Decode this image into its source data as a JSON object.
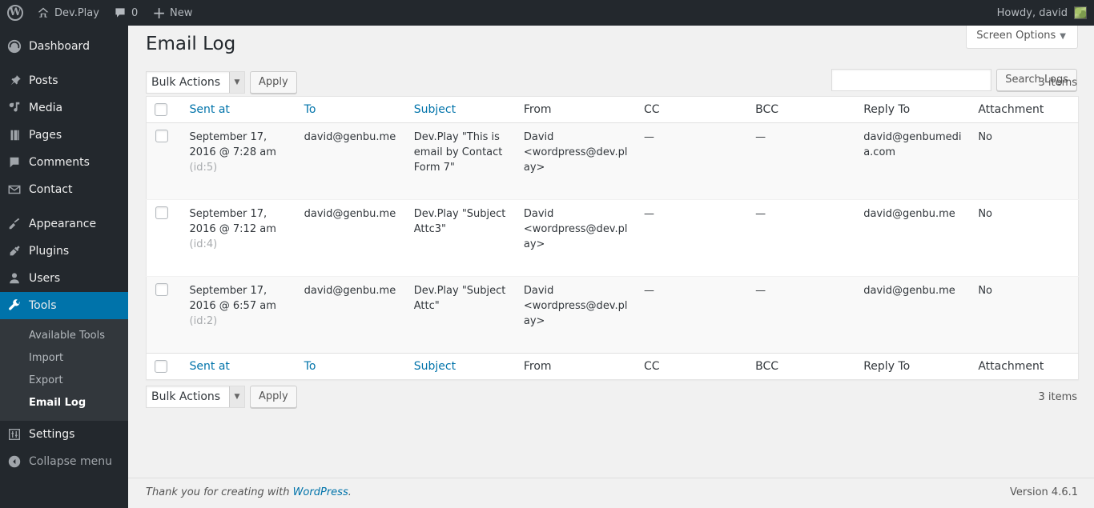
{
  "adminbar": {
    "wp_logo": "wordpress-logo",
    "site_name": "Dev.Play",
    "comment_count": "0",
    "new_label": "New",
    "howdy": "Howdy, david"
  },
  "sidebar": {
    "items": [
      {
        "label": "Dashboard",
        "icon": "dashboard-icon",
        "name": "dashboard"
      },
      {
        "label": "Posts",
        "icon": "pin-icon",
        "name": "posts"
      },
      {
        "label": "Media",
        "icon": "media-icon",
        "name": "media"
      },
      {
        "label": "Pages",
        "icon": "pages-icon",
        "name": "pages"
      },
      {
        "label": "Comments",
        "icon": "comments-icon",
        "name": "comments"
      },
      {
        "label": "Contact",
        "icon": "mail-icon",
        "name": "contact"
      },
      {
        "label": "Appearance",
        "icon": "brush-icon",
        "name": "appearance"
      },
      {
        "label": "Plugins",
        "icon": "plugin-icon",
        "name": "plugins"
      },
      {
        "label": "Users",
        "icon": "user-icon",
        "name": "users"
      },
      {
        "label": "Tools",
        "icon": "wrench-icon",
        "name": "tools"
      },
      {
        "label": "Settings",
        "icon": "settings-icon",
        "name": "settings"
      }
    ],
    "submenu": [
      {
        "label": "Available Tools",
        "current": false
      },
      {
        "label": "Import",
        "current": false
      },
      {
        "label": "Export",
        "current": false
      },
      {
        "label": "Email Log",
        "current": true
      }
    ],
    "collapse_label": "Collapse menu",
    "current_item": "Tools",
    "accent_color": "#0073aa",
    "background_color": "#23282d",
    "submenu_background": "#32373c"
  },
  "screen_options": {
    "label": "Screen Options",
    "caret": "▼"
  },
  "page": {
    "title": "Email Log"
  },
  "search": {
    "value": "",
    "placeholder": "",
    "button_label": "Search Logs"
  },
  "tablenav_top": {
    "bulk_label": "Bulk Actions",
    "apply_label": "Apply",
    "items_count": "3 items"
  },
  "tablenav_bottom": {
    "bulk_label": "Bulk Actions",
    "apply_label": "Apply",
    "items_count": "3 items"
  },
  "table": {
    "columns": [
      {
        "label": "Sent at",
        "link": true
      },
      {
        "label": "To",
        "link": true
      },
      {
        "label": "Subject",
        "link": true
      },
      {
        "label": "From",
        "link": false
      },
      {
        "label": "CC",
        "link": false
      },
      {
        "label": "BCC",
        "link": false
      },
      {
        "label": "Reply To",
        "link": false
      },
      {
        "label": "Attachment",
        "link": false
      }
    ],
    "rows": [
      {
        "date": "September 17, 2016",
        "time": "@ 7:28 am",
        "id": "(id:5)",
        "to": "david@genbu.me",
        "subject": "Dev.Play \"This is email by Contact Form 7\"",
        "from": "David <wordpress@dev.play>",
        "cc": "—",
        "bcc": "—",
        "reply_to": "david@genbumedia.com",
        "attachment": "No"
      },
      {
        "date": "September 17, 2016",
        "time": "@ 7:12 am",
        "id": "(id:4)",
        "to": "david@genbu.me",
        "subject": "Dev.Play \"Subject Attc3\"",
        "from": "David <wordpress@dev.play>",
        "cc": "—",
        "bcc": "—",
        "reply_to": "david@genbu.me",
        "attachment": "No"
      },
      {
        "date": "September 17, 2016",
        "time": "@ 6:57 am",
        "id": "(id:2)",
        "to": "david@genbu.me",
        "subject": "Dev.Play \"Subject Attc\"",
        "from": "David <wordpress@dev.play>",
        "cc": "—",
        "bcc": "—",
        "reply_to": "david@genbu.me",
        "attachment": "No"
      }
    ]
  },
  "footer": {
    "thankyou_prefix": "Thank you for creating with ",
    "wordpress_link": "WordPress",
    "thankyou_suffix": ".",
    "version": "Version 4.6.1"
  }
}
